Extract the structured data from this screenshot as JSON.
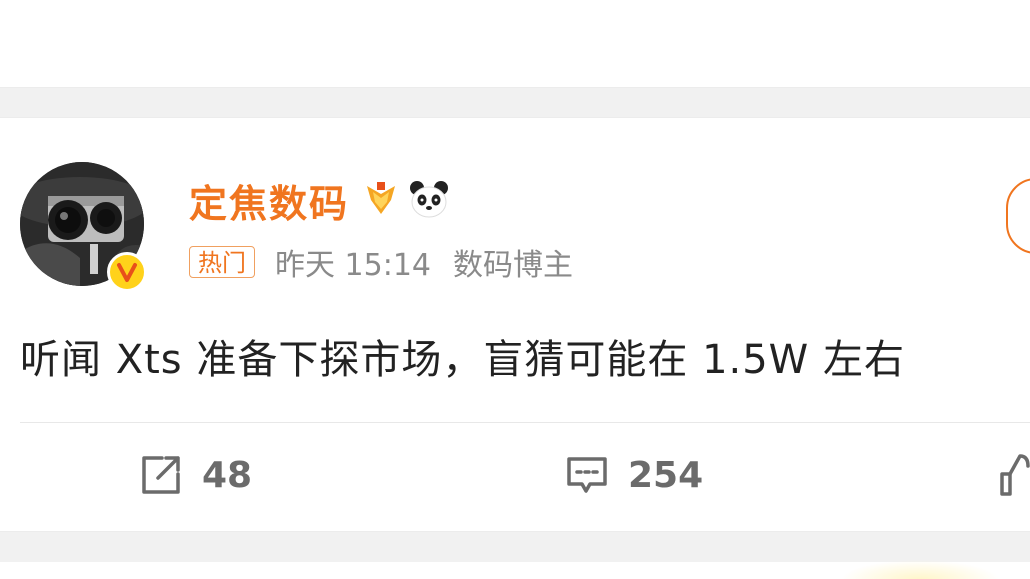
{
  "post": {
    "username": "定焦数码",
    "hot_badge": "热门",
    "time": "昨天 15:14",
    "user_tag": "数码博主",
    "text": "听闻 Xts 准备下探市场，盲猜可能在 1.5W 左右"
  },
  "actions": {
    "repost_count": "48",
    "comment_count": "254"
  },
  "colors": {
    "accent": "#f0751f",
    "meta_gray": "#8a8a8a",
    "separator": "#f1f1f1",
    "verified_badge": "#ffd21a"
  },
  "icons": [
    "verified-v-icon",
    "medal-icon",
    "panda-icon",
    "repost-icon",
    "comment-icon",
    "like-icon"
  ]
}
